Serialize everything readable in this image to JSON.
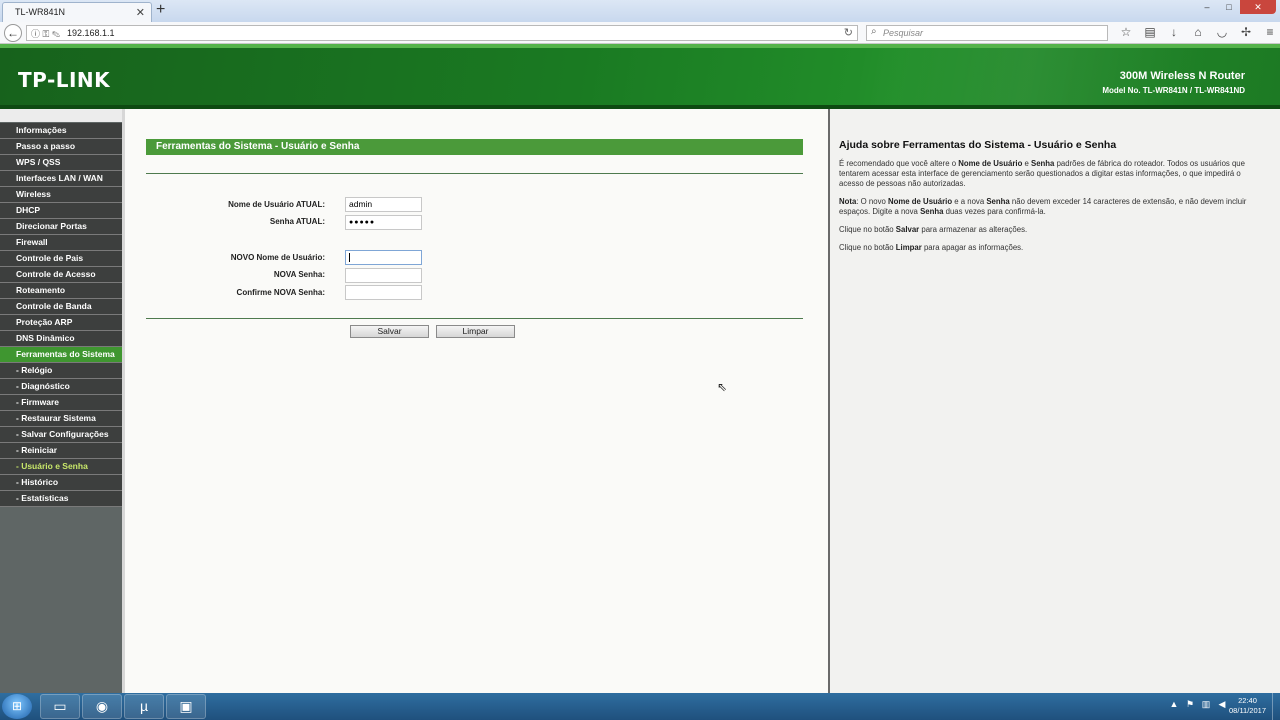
{
  "browser": {
    "tab_title": "TL-WR841N",
    "tab_close": "✕",
    "new_tab": "+",
    "url": "192.168.1.1",
    "search_placeholder": "Pesquisar"
  },
  "header": {
    "logo": "TP-LINK",
    "product_name": "300M Wireless N Router",
    "model": "Model No. TL-WR841N / TL-WR841ND"
  },
  "menu": {
    "items": [
      {
        "label": "Informações"
      },
      {
        "label": "Passo a passo"
      },
      {
        "label": "WPS / QSS"
      },
      {
        "label": "Interfaces LAN / WAN"
      },
      {
        "label": "Wireless"
      },
      {
        "label": "DHCP"
      },
      {
        "label": "Direcionar Portas"
      },
      {
        "label": "Firewall"
      },
      {
        "label": "Controle de Pais"
      },
      {
        "label": "Controle de Acesso"
      },
      {
        "label": "Roteamento"
      },
      {
        "label": "Controle de Banda"
      },
      {
        "label": "Proteção ARP"
      },
      {
        "label": "DNS Dinâmico"
      },
      {
        "label": "Ferramentas do Sistema"
      },
      {
        "label": "- Relógio"
      },
      {
        "label": "- Diagnóstico"
      },
      {
        "label": "- Firmware"
      },
      {
        "label": "- Restaurar Sistema"
      },
      {
        "label": "- Salvar Configurações"
      },
      {
        "label": "- Reiniciar"
      },
      {
        "label": "- Usuário e Senha"
      },
      {
        "label": "- Histórico"
      },
      {
        "label": "- Estatísticas"
      }
    ]
  },
  "main": {
    "section_title": "Ferramentas do Sistema - Usuário e Senha",
    "current_user_label": "Nome de Usuário ATUAL:",
    "current_user_value": "admin",
    "current_pass_label": "Senha ATUAL:",
    "current_pass_value": "●●●●●",
    "new_user_label": "NOVO Nome de Usuário:",
    "new_pass_label": "NOVA Senha:",
    "confirm_pass_label": "Confirme NOVA Senha:",
    "save_button": "Salvar",
    "clear_button": "Limpar"
  },
  "help": {
    "title": "Ajuda sobre Ferramentas do Sistema - Usuário e Senha",
    "p1_a": "É recomendado que você altere o ",
    "p1_b": "Nome de Usuário",
    "p1_c": " e ",
    "p1_d": "Senha",
    "p1_e": " padrões de fábrica do roteador. Todos os usuários que tentarem acessar esta interface de gerenciamento serão questionados a digitar estas informações, o que impedirá o acesso de pessoas não autorizadas.",
    "p2_a": "Nota",
    "p2_b": ": O novo ",
    "p2_c": "Nome de Usuário",
    "p2_d": " e a nova ",
    "p2_e": "Senha",
    "p2_f": " não devem exceder 14 caracteres de extensão, e não devem incluir espaços. Digite a nova ",
    "p2_g": "Senha",
    "p2_h": " duas vezes para confirmá-la.",
    "p3_a": "Clique no botão ",
    "p3_b": "Salvar",
    "p3_c": " para armazenar as alterações.",
    "p4_a": "Clique no botão ",
    "p4_b": "Limpar",
    "p4_c": " para apagar as informações."
  },
  "taskbar": {
    "time": "22:40",
    "date": "08/11/2017"
  },
  "colors": {
    "brand_green": "#1a7a22",
    "menu_active": "#3f9630",
    "menu_current_text": "#c9e86a",
    "section_bar": "#4b9a3a"
  }
}
